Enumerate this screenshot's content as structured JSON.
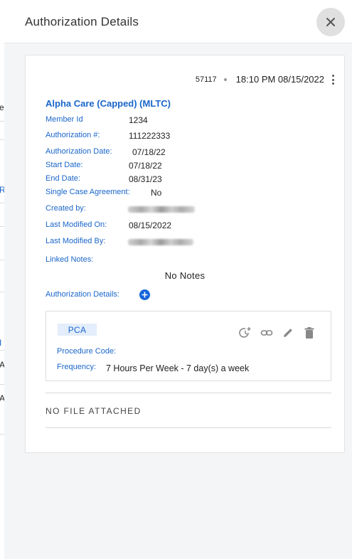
{
  "drawer": {
    "title": "Authorization Details",
    "close_icon": "close-icon"
  },
  "background_fragments": [
    "e",
    "R",
    "I",
    "A",
    "A"
  ],
  "card": {
    "record_id": "57117",
    "timestamp": "18:10 PM 08/15/2022",
    "menu_icon": "more-vert-icon",
    "org_name": "Alpha Care (Capped) (MLTC)",
    "fields": {
      "member_id": {
        "label": "Member Id",
        "value": "1234"
      },
      "auth_number": {
        "label": "Authorization #:",
        "value": "111222333"
      },
      "auth_date": {
        "label": "Authorization Date:",
        "value": "07/18/22"
      },
      "start_date": {
        "label": "Start Date:",
        "value": "07/18/22"
      },
      "end_date": {
        "label": "End Date:",
        "value": "08/31/23"
      },
      "single_case": {
        "label": "Single Case Agreement:",
        "value": "No"
      },
      "created_by": {
        "label": "Created by:"
      },
      "last_modified_on": {
        "label": "Last Modified On:",
        "value": "08/15/2022"
      },
      "last_modified_by": {
        "label": "Last Modified By:"
      },
      "linked_notes": {
        "label": "Linked Notes:"
      }
    },
    "no_notes": "No Notes",
    "auth_details_label": "Authorization Details:",
    "add_icon": "add-circle-icon",
    "detail": {
      "chip": "PCA",
      "procedure_code_label": "Procedure Code:",
      "frequency_label": "Frequency:",
      "frequency_value": "7 Hours Per Week - 7 day(s) a week",
      "icons": [
        "history-add-icon",
        "link-icon",
        "edit-icon",
        "delete-icon"
      ]
    },
    "no_file": "NO FILE ATTACHED"
  },
  "colors": {
    "accent": "#1a66c9",
    "chip_bg": "#e3edfb",
    "add_button": "#1565d8"
  }
}
